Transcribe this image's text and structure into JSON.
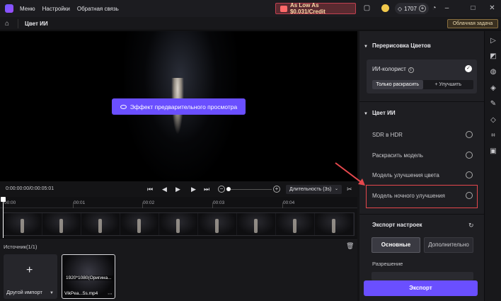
{
  "titlebar": {
    "menu": [
      "Меню",
      "Настройки",
      "Обратная связь"
    ],
    "promo": "As Low As $0.031/Credit",
    "credits": "1707"
  },
  "subbar": {
    "title": "Цвет ИИ",
    "cloud_task": "Облачная задача"
  },
  "preview": {
    "button_label": "Эффект предварительного просмотра"
  },
  "playback": {
    "timecode": "0:00:00:00/0:00:05:01",
    "duration": "Длительность (3s)"
  },
  "timeline": {
    "ticks": [
      "00:00",
      "00:01",
      "00:02",
      "00:03",
      "00:04"
    ]
  },
  "media": {
    "title": "Источник(1/1)",
    "import_label": "Другой импорт",
    "clip_resolution": "1920*1080(Оригина...",
    "clip_name": "VikPea...5s.mp4"
  },
  "panel": {
    "section1_title": "Перерисовка Цветов",
    "card_title": "ИИ-колорист",
    "seg_left": "Только раскрасить",
    "seg_right": "+ Улучшить",
    "section2_title": "Цвет ИИ",
    "options": [
      "SDR в HDR",
      "Раскрасить модель",
      "Модель улучшения цвета",
      "Модель ночного улучшения"
    ],
    "export_title": "Экспорт настроек",
    "tab_basic": "Основные",
    "tab_advanced": "Дополнительно",
    "resolution_label": "Разрешение",
    "export_button": "Экспорт"
  },
  "colors": {
    "accent": "#6a4fff",
    "highlight": "#e5484d"
  }
}
